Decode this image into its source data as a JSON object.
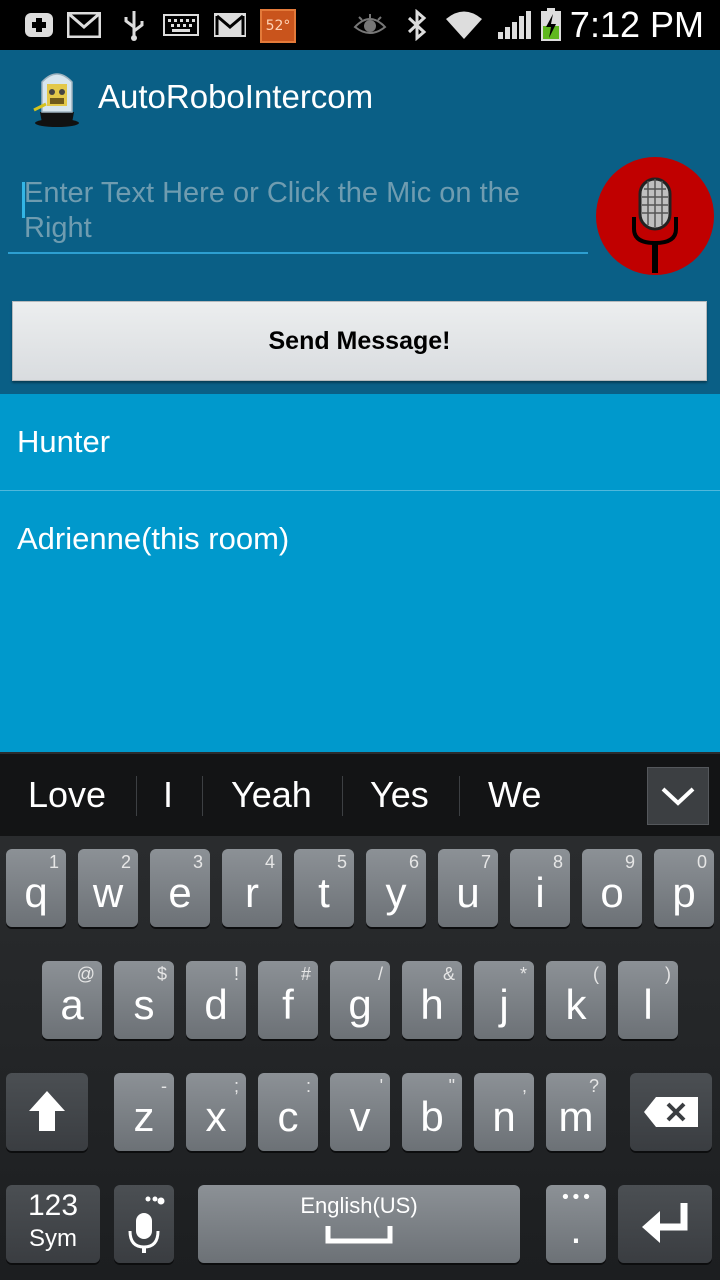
{
  "status_bar": {
    "temperature": "52°",
    "time": "7:12 PM"
  },
  "app": {
    "title": "AutoRoboIntercom",
    "input_placeholder": "Enter Text Here or Click the Mic on the Right",
    "send_button": "Send Message!"
  },
  "rooms": [
    "Hunter",
    "Adrienne(this room)"
  ],
  "keyboard": {
    "suggestions": [
      "Love",
      "I",
      "Yeah",
      "Yes",
      "We"
    ],
    "row1": [
      {
        "k": "q",
        "h": "1"
      },
      {
        "k": "w",
        "h": "2"
      },
      {
        "k": "e",
        "h": "3"
      },
      {
        "k": "r",
        "h": "4"
      },
      {
        "k": "t",
        "h": "5"
      },
      {
        "k": "y",
        "h": "6"
      },
      {
        "k": "u",
        "h": "7"
      },
      {
        "k": "i",
        "h": "8"
      },
      {
        "k": "o",
        "h": "9"
      },
      {
        "k": "p",
        "h": "0"
      }
    ],
    "row2": [
      {
        "k": "a",
        "h": "@"
      },
      {
        "k": "s",
        "h": "$"
      },
      {
        "k": "d",
        "h": "!"
      },
      {
        "k": "f",
        "h": "#"
      },
      {
        "k": "g",
        "h": "/"
      },
      {
        "k": "h",
        "h": "&"
      },
      {
        "k": "j",
        "h": "*"
      },
      {
        "k": "k",
        "h": "("
      },
      {
        "k": "l",
        "h": ")"
      }
    ],
    "row3": [
      {
        "k": "z",
        "h": "-"
      },
      {
        "k": "x",
        "h": ";"
      },
      {
        "k": "c",
        "h": ":"
      },
      {
        "k": "v",
        "h": "'"
      },
      {
        "k": "b",
        "h": "\""
      },
      {
        "k": "n",
        "h": ","
      },
      {
        "k": "m",
        "h": "?"
      }
    ],
    "sym_top": "123",
    "sym_bottom": "Sym",
    "space_label": "English(US)",
    "period": "."
  }
}
